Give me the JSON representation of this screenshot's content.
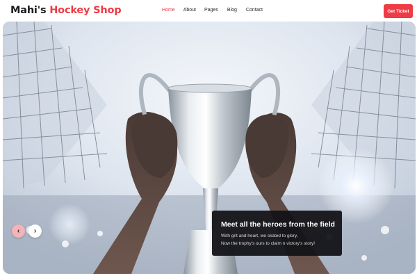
{
  "header": {
    "brand_part1": "Mahi's",
    "brand_part2": "Hockey Shop",
    "nav": [
      "Home",
      "About",
      "Pages",
      "Blog",
      "Contact"
    ],
    "active_nav": "Home",
    "cta_label": "Get Ticket"
  },
  "hero": {
    "title": "Meet all the heroes from the field",
    "line1": "With grit and heart, we skated to glory,",
    "line2": "Now the trophy's ours to claim n victory's story!",
    "prev_icon": "‹",
    "next_icon": "›"
  },
  "colors": {
    "accent": "#ef3b44",
    "caption_bg": "#121216",
    "brand_dark": "#1b1b1f"
  },
  "icons": [
    "chevron-left-icon",
    "chevron-right-icon"
  ]
}
